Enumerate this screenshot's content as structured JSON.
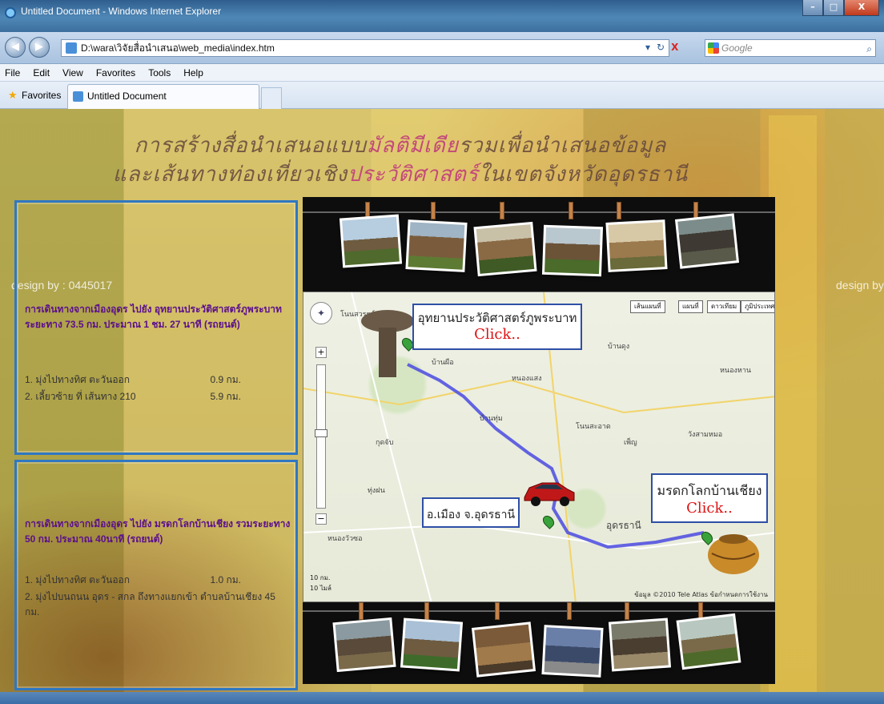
{
  "window": {
    "title": "Untitled Document - Windows Internet Explorer",
    "min": "–",
    "max": "□",
    "close": "X"
  },
  "toolbar": {
    "back": "◀",
    "forward": "▶",
    "address": "D:\\wara\\วิจัยสื่อนำเสนอ\\web_media\\index.htm",
    "dropdown": "▾",
    "refresh": "↻",
    "stop": "X",
    "search_placeholder": "Google",
    "search_go": "⌕"
  },
  "menu": [
    "File",
    "Edit",
    "View",
    "Favorites",
    "Tools",
    "Help"
  ],
  "tabbar": {
    "favorites": "Favorites",
    "tab": "Untitled Document"
  },
  "page": {
    "heading_line1a": "การสร้างสื่อนำเสนอแบบ",
    "heading_line1b": "มัลติมีเดีย",
    "heading_line1c": "รวมเพื่อนำเสนอข้อมูล",
    "heading_line2a": "และเส้นทางท่องเที่ยวเชิง",
    "heading_line2b": "ประวัติศาสตร์",
    "heading_line2c": "ในเขตจังหวัดอุดรธานี",
    "credit": "design by : 0445017",
    "credit_right": "design by",
    "panel1": {
      "route": "การเดินทางจากเมืองอุดร ไปยัง อุทยานประวัติศาสตร์ภูพระบาท ระยะทาง 73.5 กม. ประมาณ 1 ชม. 27 นาที (รถยนต์)",
      "steps": [
        {
          "text": "1. มุ่งไปทางทิศ ตะวันออก",
          "dist": "0.9 กม."
        },
        {
          "text": "2. เลี้ยวซ้าย ที่ เส้นทาง 210",
          "dist": "5.9 กม."
        }
      ]
    },
    "panel2": {
      "route": "การเดินทางจากเมืองอุดร ไปยัง มรดกโลกบ้านเชียง รวมระยะทาง 50 กม. ประมาณ 40นาที (รถยนต์)",
      "steps": [
        {
          "text": "1. มุ่งไปทางทิศ ตะวันออก",
          "dist": "1.0 กม."
        },
        {
          "text": "2. มุ่งไปบนถนน อุดร - สกล ถึงทางแยกเข้า ตำบลบ้านเชียง 45 กม.",
          "dist": ""
        }
      ]
    },
    "map": {
      "callout_phu": "อุทยานประวัติศาสตร์ภูพระบาท",
      "callout_chiang": "มรดกโลกบ้านเชียง",
      "callout_city": "อ.เมือง จ.อุดรธานี",
      "click": "Click..",
      "btn1": "เส้นแผนที่",
      "btn2": "แผนที่",
      "btn3": "ดาวเทียม",
      "btn4": "ภูมิประเทศ",
      "city_label": "อุดรธานี",
      "scale1": "10 กม.",
      "scale2": "10 ไมล์",
      "footer": "ข้อมูล ©2010 Tele Atlas ข้อกำหนดการใช้งาน",
      "labels": [
        "โนนสวรรค์",
        "บ้านผือ",
        "หนองแสง",
        "บ้านดุง",
        "กุดจับ",
        "หนองหาน",
        "เพ็ญ",
        "บ้านทุ่ม",
        "ทุ่งฝน",
        "โนนสะอาด",
        "วังสามหมอ",
        "หนองวัวซอ"
      ],
      "pan": "✦",
      "zoom_in": "+",
      "zoom_out": "−"
    }
  }
}
